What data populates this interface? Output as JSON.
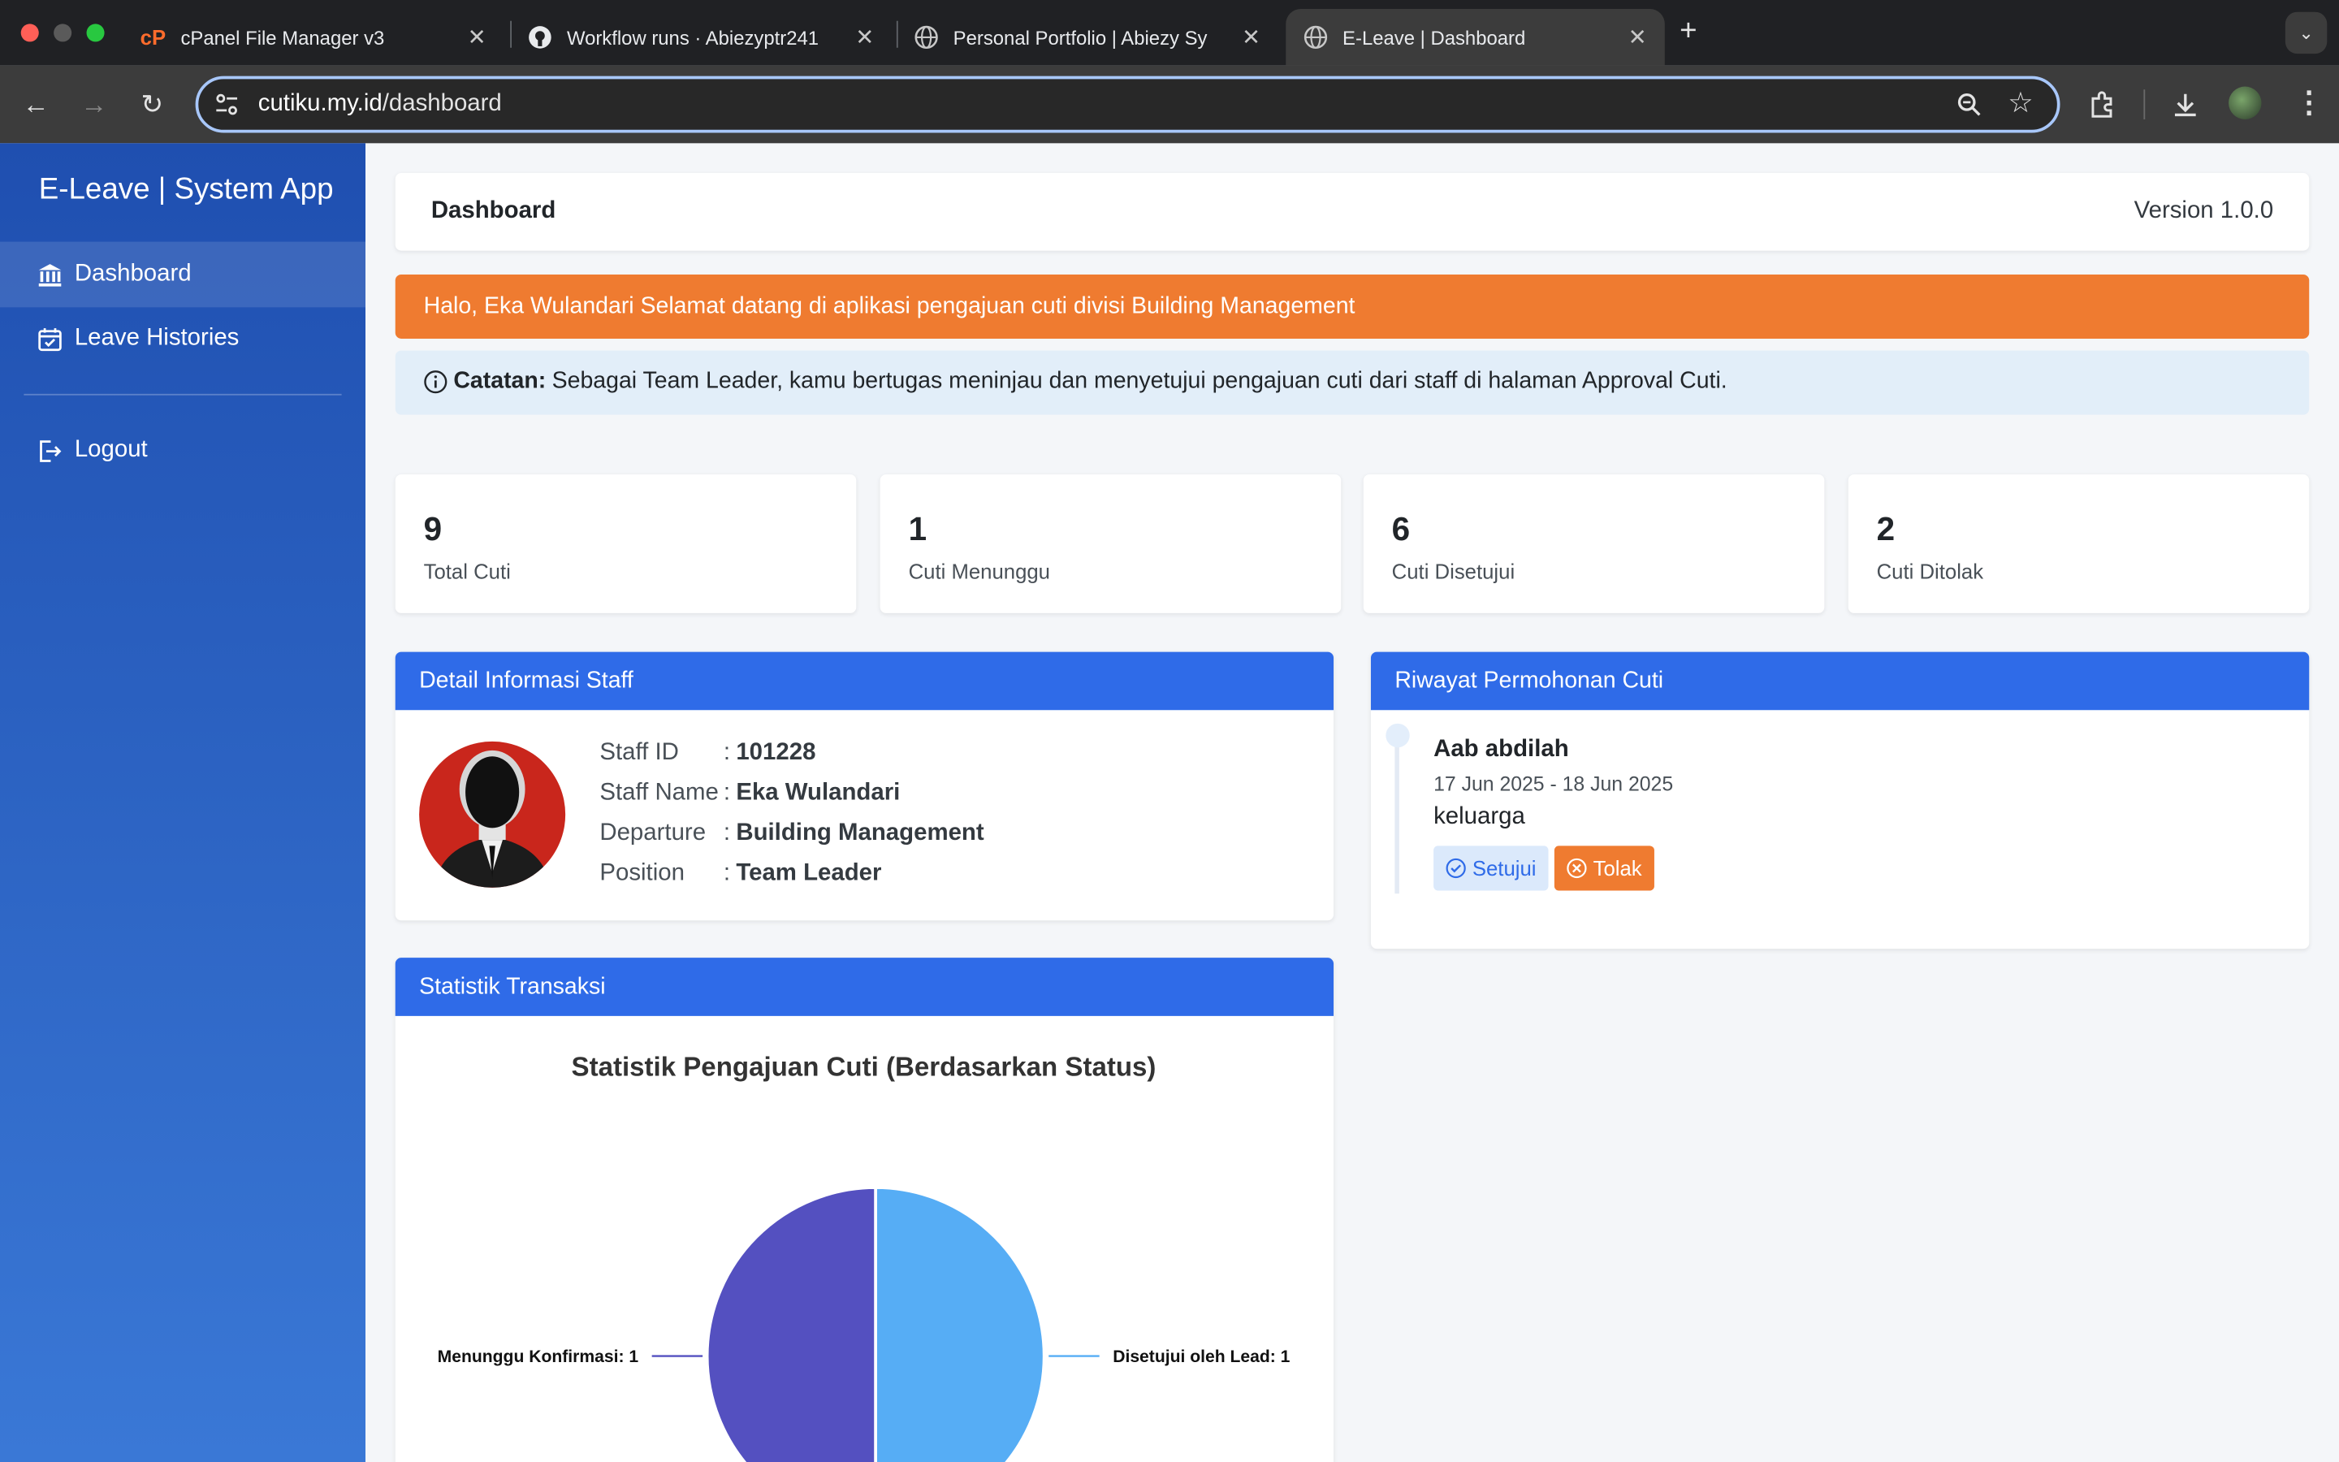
{
  "browser": {
    "tabs": [
      {
        "title": "cPanel File Manager v3",
        "icon": "cpanel-icon",
        "active": false
      },
      {
        "title": "Workflow runs · Abiezyptr241",
        "icon": "github-icon",
        "active": false
      },
      {
        "title": "Personal Portfolio | Abiezy Sy",
        "icon": "globe-icon",
        "active": false
      },
      {
        "title": "E-Leave | Dashboard",
        "icon": "globe-icon",
        "active": true
      }
    ],
    "url_host": "cutiku.my.id",
    "url_path": "/dashboard"
  },
  "sidebar": {
    "brand": "E-Leave | System App",
    "items": [
      {
        "label": "Dashboard",
        "icon": "bank-icon",
        "active": true
      },
      {
        "label": "Leave Histories",
        "icon": "calendar-check-icon",
        "active": false
      },
      {
        "label": "Logout",
        "icon": "logout-icon",
        "active": false
      }
    ]
  },
  "header": {
    "title": "Dashboard",
    "version": "Version 1.0.0"
  },
  "welcome": "Halo, Eka Wulandari Selamat datang di aplikasi pengajuan cuti divisi Building Management",
  "note": {
    "label": "Catatan:",
    "text": "Sebagai Team Leader, kamu bertugas meninjau dan menyetujui pengajuan cuti dari staff di halaman Approval Cuti."
  },
  "stats": [
    {
      "value": "9",
      "label": "Total Cuti"
    },
    {
      "value": "1",
      "label": "Cuti Menunggu"
    },
    {
      "value": "6",
      "label": "Cuti Disetujui"
    },
    {
      "value": "2",
      "label": "Cuti Ditolak"
    }
  ],
  "staff": {
    "panel_title": "Detail Informasi Staff",
    "fields": [
      {
        "key": "Staff ID",
        "value": "101228"
      },
      {
        "key": "Staff Name",
        "value": "Eka Wulandari"
      },
      {
        "key": "Departure",
        "value": "Building Management"
      },
      {
        "key": "Position",
        "value": "Team Leader"
      }
    ]
  },
  "history": {
    "panel_title": "Riwayat Permohonan Cuti",
    "entries": [
      {
        "name": "Aab abdilah",
        "dates": "17 Jun 2025 - 18 Jun 2025",
        "reason": "keluarga",
        "approve_label": "Setujui",
        "reject_label": "Tolak"
      }
    ]
  },
  "statistics": {
    "panel_title": "Statistik Transaksi"
  },
  "colors": {
    "sidebar_top": "#1f4fb0",
    "accent": "#2f6be8",
    "alert_orange": "#ef7b30",
    "approve": "#dbe9fb",
    "reject": "#ef7b30"
  },
  "chart_data": {
    "type": "pie",
    "title": "Statistik Pengajuan Cuti (Berdasarkan Status)",
    "slices": [
      {
        "label": "Menunggu Konfirmasi",
        "value": 1,
        "color": "#5450c0"
      },
      {
        "label": "Disetujui oleh Lead",
        "value": 1,
        "color": "#56adf5"
      }
    ]
  }
}
